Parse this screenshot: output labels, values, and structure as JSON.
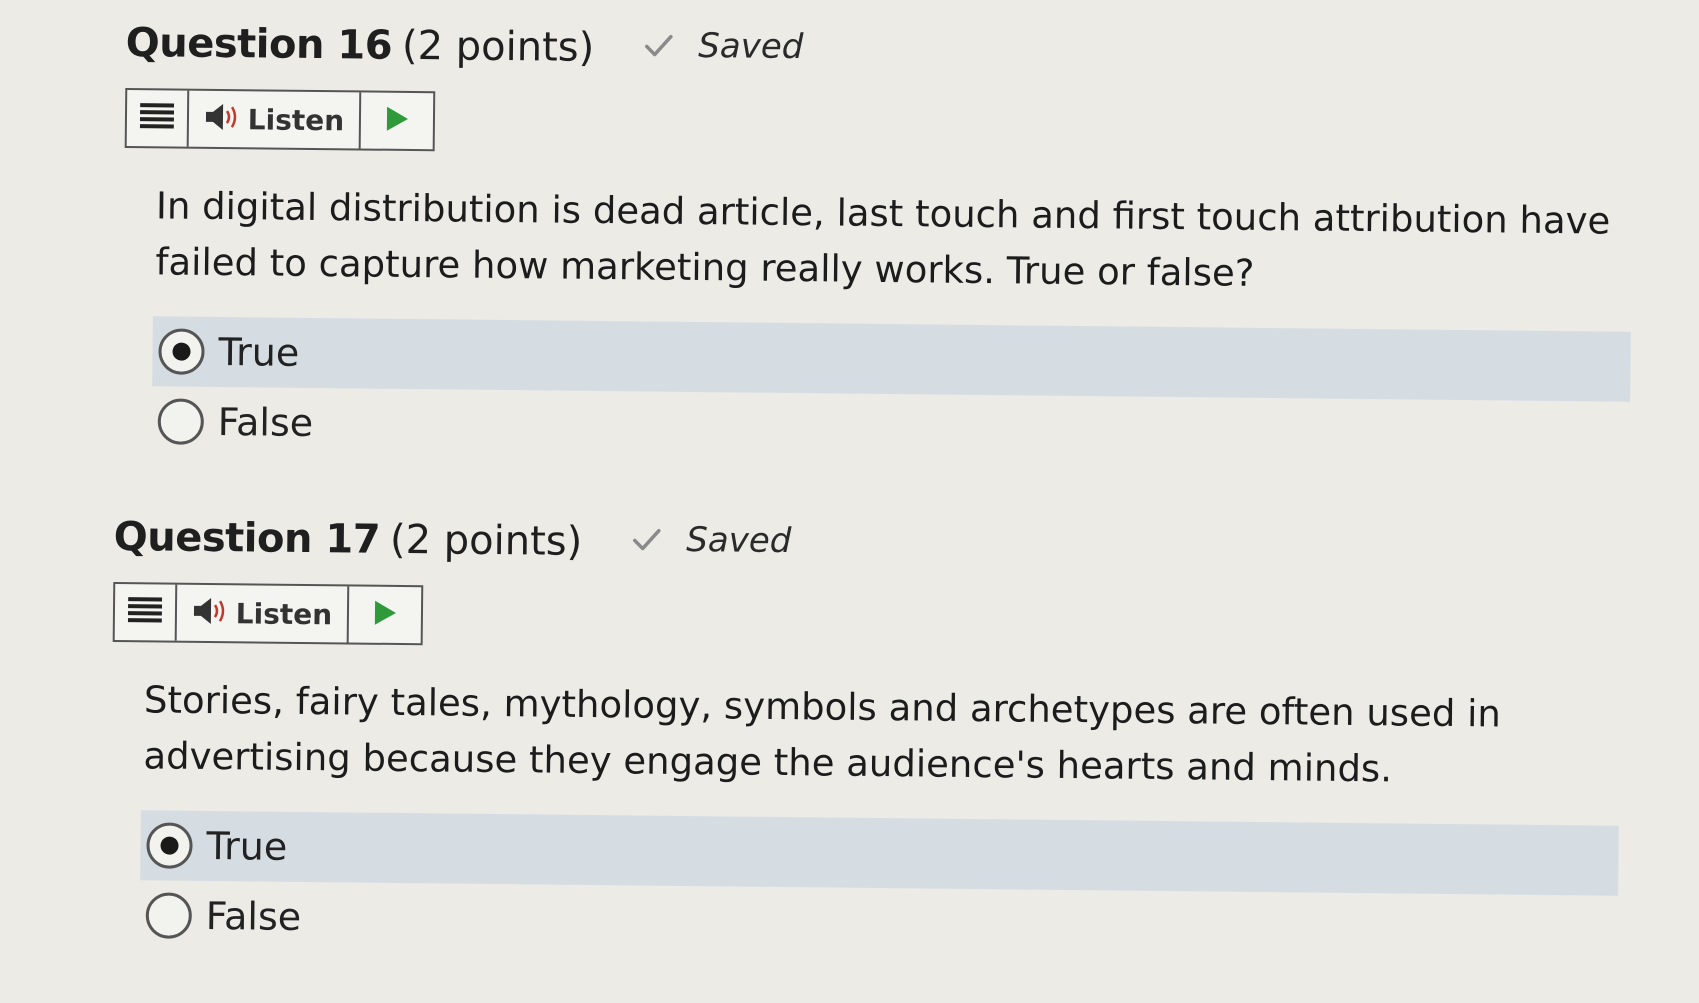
{
  "colors": {
    "page_bg": "#ecebe6",
    "selected_row": "#d5dde2",
    "play_green": "#2f9a3a",
    "check_gray": "#8a8a8a"
  },
  "questions": [
    {
      "title": "Question 16",
      "points": "(2 points)",
      "status": "Saved",
      "listen_label": "Listen",
      "text": "In digital distribution is dead article, last touch and first touch attribution have failed to capture how marketing really works. True or false?",
      "options": [
        {
          "label": "True",
          "selected": true
        },
        {
          "label": "False",
          "selected": false
        }
      ]
    },
    {
      "title": "Question 17",
      "points": "(2 points)",
      "status": "Saved",
      "listen_label": "Listen",
      "text": "Stories, fairy tales, mythology, symbols and archetypes are often used in advertising because they engage the audience's hearts and minds.",
      "options": [
        {
          "label": "True",
          "selected": true
        },
        {
          "label": "False",
          "selected": false
        }
      ]
    }
  ],
  "icons": {
    "menu": "menu-icon",
    "speaker": "speaker-icon",
    "play": "play-icon",
    "check": "check-icon"
  }
}
